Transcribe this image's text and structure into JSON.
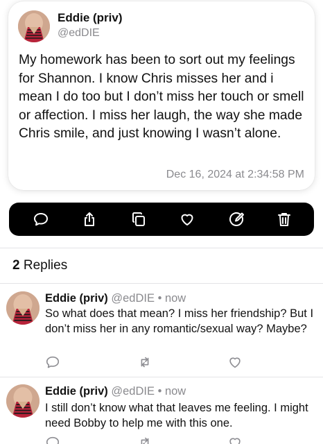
{
  "post": {
    "author_name": "Eddie (priv)",
    "author_handle": "@edDIE",
    "text": "My homework has been to sort out my feelings for Shannon.  I know Chris misses her and i mean I do too but I don’t miss her touch or smell or affection. I miss her laugh, the way she made Chris smile, and just knowing I wasn’t alone.",
    "timestamp": "Dec 16, 2024 at 2:34:58 PM"
  },
  "actions": [
    {
      "icon": "comment-icon"
    },
    {
      "icon": "share-icon"
    },
    {
      "icon": "copy-icon"
    },
    {
      "icon": "heart-icon"
    },
    {
      "icon": "edit-icon"
    },
    {
      "icon": "trash-icon"
    }
  ],
  "replies_header": {
    "count": "2",
    "label": "Replies"
  },
  "replies": [
    {
      "author_name": "Eddie (priv)",
      "author_handle": "@edDIE",
      "separator": "•",
      "time": "now",
      "text": "So what does that mean? I miss her friendship? But I don’t miss her in any romantic/sexual way? Maybe?"
    },
    {
      "author_name": "Eddie (priv)",
      "author_handle": "@edDIE",
      "separator": "•",
      "time": "now",
      "text": "I still don’t know what that leaves me feeling. I might need Bobby to help me with this one."
    }
  ],
  "colors": {
    "action_bar_bg": "#000000",
    "secondary_text": "#8a8a8e",
    "icon_gray": "#8e8e93"
  }
}
